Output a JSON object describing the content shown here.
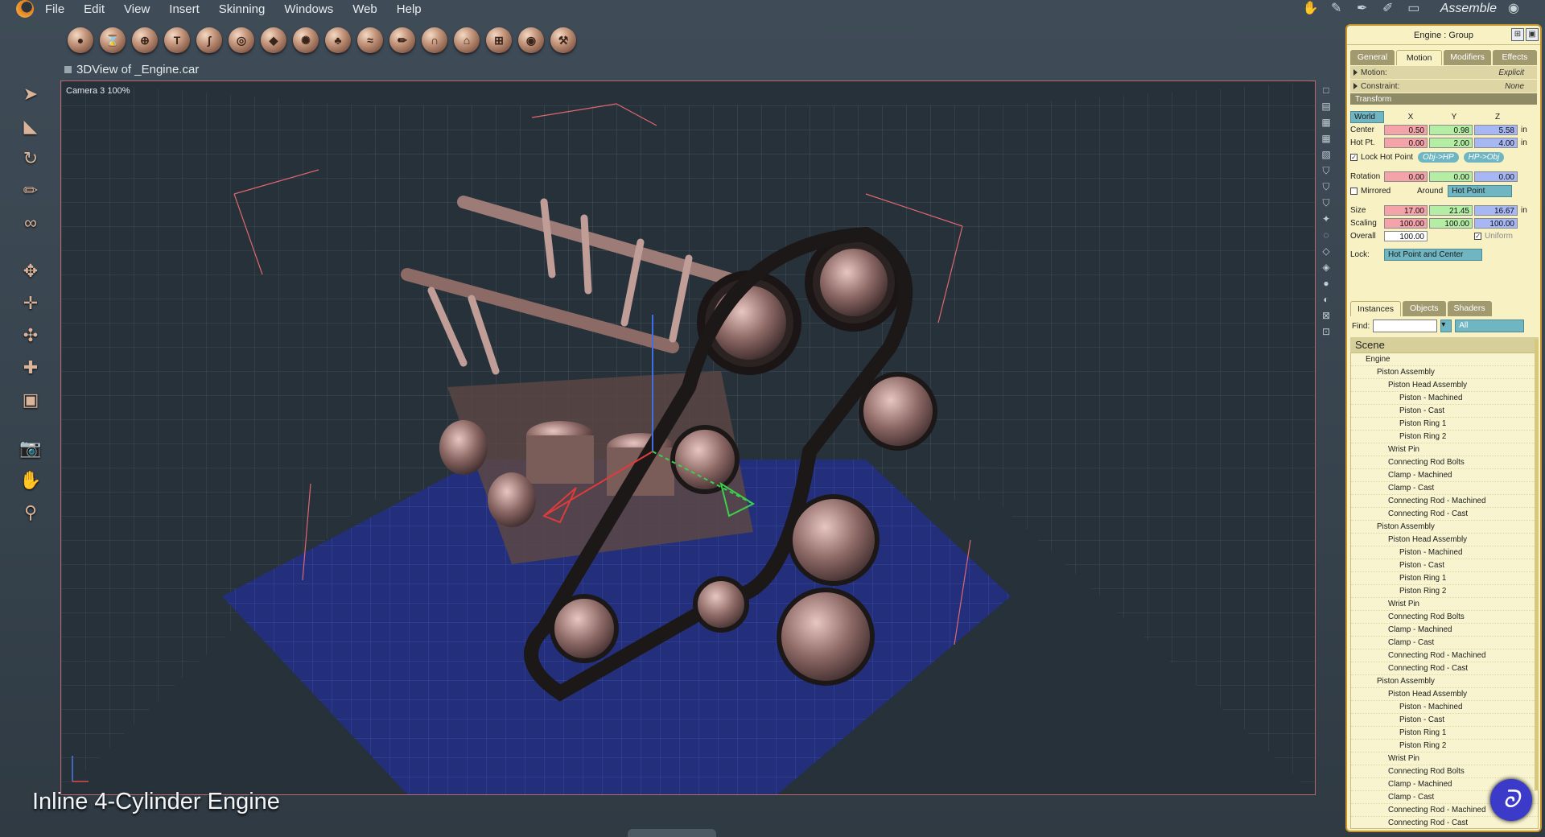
{
  "menu": {
    "items": [
      "File",
      "Edit",
      "View",
      "Insert",
      "Skinning",
      "Windows",
      "Web",
      "Help"
    ],
    "room": "Assemble"
  },
  "toolbar": {
    "icons": [
      "sphere-tool-icon",
      "bevel-tool-icon",
      "globe-tool-icon",
      "text-tool-icon",
      "freeform-tool-icon",
      "eye-tool-icon",
      "shape-tool-icon",
      "gear-tool-icon",
      "tree-tool-icon",
      "sketch-tool-icon",
      "lathe-tool-icon",
      "magnet-tool-icon",
      "bag-tool-icon",
      "fence-tool-icon",
      "target-tool-icon",
      "wrench-tool-icon"
    ]
  },
  "view": {
    "title": "3DView of _Engine.car",
    "camera": "Camera 3 100%",
    "caption": "Inline 4-Cylinder Engine"
  },
  "panel": {
    "header": "Engine : Group",
    "tabs": [
      "General",
      "Motion",
      "Modifiers",
      "Effects"
    ],
    "motion": {
      "label": "Motion:",
      "value": "Explicit"
    },
    "constraint": {
      "label": "Constraint:",
      "value": "None"
    },
    "transform_label": "Transform",
    "space": "World",
    "axes": [
      "X",
      "Y",
      "Z"
    ],
    "center": {
      "label": "Center",
      "x": "0.50",
      "y": "0.98",
      "z": "5.58"
    },
    "hotpt": {
      "label": "Hot Pt.",
      "x": "0.00",
      "y": "2.00",
      "z": "4.00"
    },
    "unit": "in",
    "lock_hot_point": "Lock Hot Point",
    "obj_hp": "Obj->HP",
    "hp_obj": "HP->Obj",
    "rotation": {
      "label": "Rotation",
      "x": "0.00",
      "y": "0.00",
      "z": "0.00"
    },
    "mirrored": "Mirrored",
    "around": "Around",
    "around_value": "Hot Point",
    "size": {
      "label": "Size",
      "x": "17.00",
      "y": "21.45",
      "z": "16.67"
    },
    "scaling": {
      "label": "Scaling",
      "x": "100.00",
      "y": "100.00",
      "z": "100.00"
    },
    "overall": {
      "label": "Overall",
      "value": "100.00"
    },
    "uniform": "Uniform",
    "lock": {
      "label": "Lock:",
      "value": "Hot Point and Center"
    }
  },
  "browser": {
    "tabs": [
      "Instances",
      "Objects",
      "Shaders"
    ],
    "find_label": "Find:",
    "find_value": "",
    "scope": "All",
    "scene_title": "Scene",
    "tree": [
      {
        "label": "Engine",
        "level": 0
      },
      {
        "label": "Piston Assembly",
        "level": 1
      },
      {
        "label": "Piston Head Assembly",
        "level": 2
      },
      {
        "label": "Piston - Machined",
        "level": 3
      },
      {
        "label": "Piston - Cast",
        "level": 3
      },
      {
        "label": "Piston Ring 1",
        "level": 3
      },
      {
        "label": "Piston Ring 2",
        "level": 3
      },
      {
        "label": "Wrist Pin",
        "level": 2
      },
      {
        "label": "Connecting Rod Bolts",
        "level": 2
      },
      {
        "label": "Clamp - Machined",
        "level": 2
      },
      {
        "label": "Clamp - Cast",
        "level": 2
      },
      {
        "label": "Connecting Rod - Machined",
        "level": 2
      },
      {
        "label": "Connecting Rod - Cast",
        "level": 2
      },
      {
        "label": "Piston Assembly",
        "level": 1
      },
      {
        "label": "Piston Head Assembly",
        "level": 2
      },
      {
        "label": "Piston - Machined",
        "level": 3
      },
      {
        "label": "Piston - Cast",
        "level": 3
      },
      {
        "label": "Piston Ring 1",
        "level": 3
      },
      {
        "label": "Piston Ring 2",
        "level": 3
      },
      {
        "label": "Wrist Pin",
        "level": 2
      },
      {
        "label": "Connecting Rod Bolts",
        "level": 2
      },
      {
        "label": "Clamp - Machined",
        "level": 2
      },
      {
        "label": "Clamp - Cast",
        "level": 2
      },
      {
        "label": "Connecting Rod - Machined",
        "level": 2
      },
      {
        "label": "Connecting Rod - Cast",
        "level": 2
      },
      {
        "label": "Piston Assembly",
        "level": 1
      },
      {
        "label": "Piston Head Assembly",
        "level": 2
      },
      {
        "label": "Piston - Machined",
        "level": 3
      },
      {
        "label": "Piston - Cast",
        "level": 3
      },
      {
        "label": "Piston Ring 1",
        "level": 3
      },
      {
        "label": "Piston Ring 2",
        "level": 3
      },
      {
        "label": "Wrist Pin",
        "level": 2
      },
      {
        "label": "Connecting Rod Bolts",
        "level": 2
      },
      {
        "label": "Clamp - Machined",
        "level": 2
      },
      {
        "label": "Clamp - Cast",
        "level": 2
      },
      {
        "label": "Connecting Rod - Machined",
        "level": 2
      },
      {
        "label": "Connecting Rod - Cast",
        "level": 2
      }
    ]
  },
  "colors": {
    "accent": "#c8942d",
    "panel_bg": "#f7f1c4",
    "x_field": "#f4a3a9",
    "y_field": "#b4eda4",
    "z_field": "#a6b7f4",
    "viewport_border": "#b76a6e",
    "floor": "#2b3a8c"
  }
}
